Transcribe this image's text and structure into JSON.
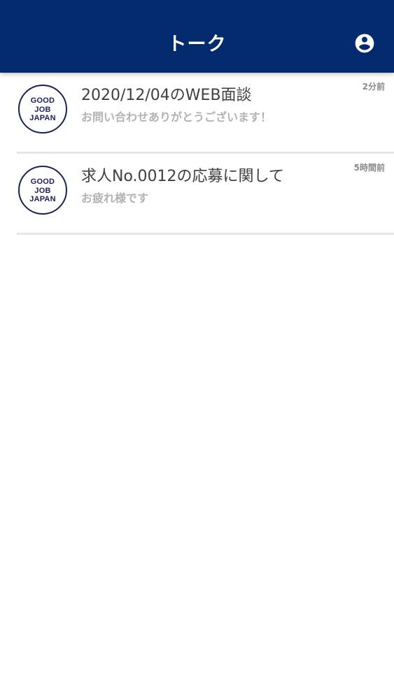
{
  "colors": {
    "header_bg": "#032a6c",
    "header_text": "#ffffff",
    "logo_navy": "#1b2157",
    "title_text": "#3f3f3f",
    "preview_text": "#b3b3b3",
    "time_text": "#8a8a8a",
    "divider": "#e6e6e6"
  },
  "header": {
    "title": "トーク",
    "account_icon": "account-circle-icon"
  },
  "talks": [
    {
      "avatar_lines": [
        "GOOD",
        "JOB",
        "JAPAN"
      ],
      "title": "2020/12/04のWEB面談",
      "preview": "お問い合わせありがとうございます！",
      "time": "2分前"
    },
    {
      "avatar_lines": [
        "GOOD",
        "JOB",
        "JAPAN"
      ],
      "title": "求人No.0012の応募に関して",
      "preview": "お疲れ様です",
      "time": "5時間前"
    }
  ]
}
